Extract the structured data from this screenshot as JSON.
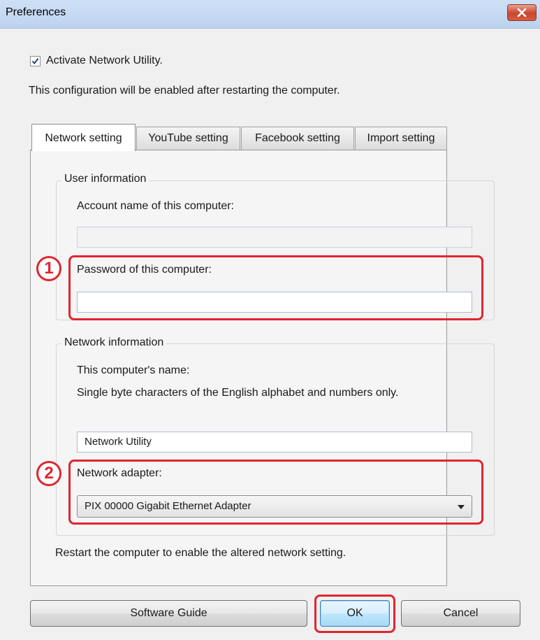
{
  "window": {
    "title": "Preferences",
    "close_icon": "close-icon"
  },
  "activate": {
    "label": "Activate Network Utility.",
    "checked": true
  },
  "note_restart": "This configuration will be enabled after restarting the computer.",
  "tabs": [
    {
      "label": "Network setting",
      "active": true
    },
    {
      "label": "YouTube setting",
      "active": false
    },
    {
      "label": "Facebook setting",
      "active": false
    },
    {
      "label": "Import setting",
      "active": false
    }
  ],
  "user_info": {
    "legend": "User information",
    "account_label": "Account name of this computer:",
    "account_value": "",
    "password_label": "Password of this computer:",
    "password_value": ""
  },
  "network_info": {
    "legend": "Network information",
    "name_label": "This computer's name:",
    "name_hint": "Single byte characters of the English alphabet and numbers only.",
    "name_value": "Network Utility",
    "adapter_label": "Network adapter:",
    "adapter_value": "PIX 00000 Gigabit Ethernet Adapter"
  },
  "restart_note": "Restart the computer to enable the altered network setting.",
  "buttons": {
    "software_guide": "Software Guide",
    "ok": "OK",
    "cancel": "Cancel"
  },
  "callouts": [
    "1",
    "2"
  ],
  "colors": {
    "highlight": "#e0262e",
    "titlebar": "#bcd3ef",
    "default_button": "#bee6fd"
  }
}
